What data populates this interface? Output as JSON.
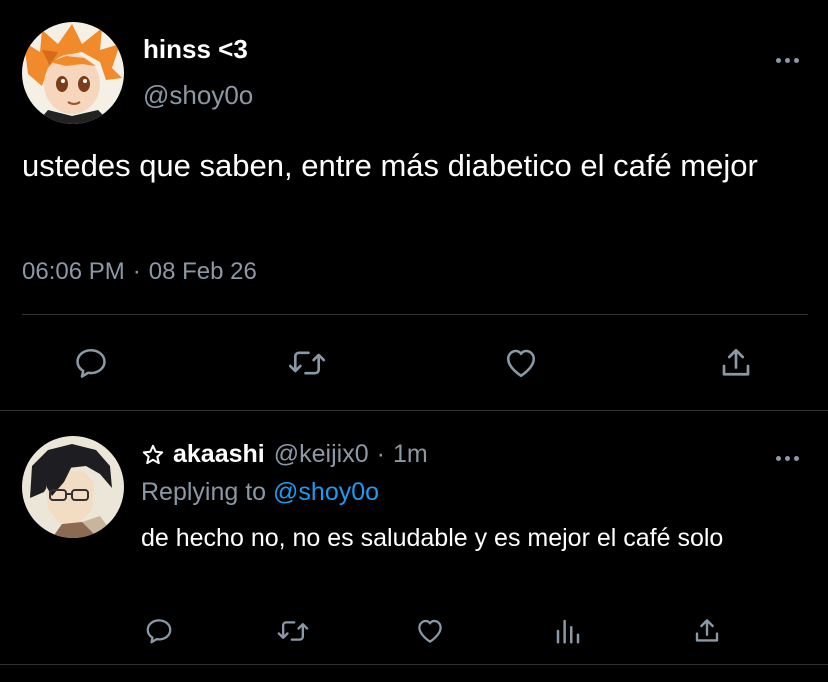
{
  "main_tweet": {
    "display_name": "hinss <3",
    "handle": "@shoy0o",
    "text": "ustedes que saben, entre más diabetico el café mejor",
    "time": "06:06 PM",
    "separator": "·",
    "date": "08 Feb 26",
    "actions": [
      "reply-icon",
      "retweet-icon",
      "like-icon",
      "share-icon"
    ]
  },
  "reply_tweet": {
    "display_name": "akaashi",
    "handle": "@keijix0",
    "separator": "·",
    "time_ago": "1m",
    "replying_prefix": "Replying to",
    "replying_to": "@shoy0o",
    "text": "de hecho no, no es saludable y es mejor el café solo",
    "actions": [
      "reply-icon",
      "retweet-icon",
      "like-icon",
      "analytics-icon",
      "share-icon"
    ]
  },
  "colors": {
    "background": "#000000",
    "text": "#ffffff",
    "secondary": "#8b98a5",
    "link": "#1d9bf0",
    "divider": "#2f3336",
    "icon": "#8b98a5"
  }
}
